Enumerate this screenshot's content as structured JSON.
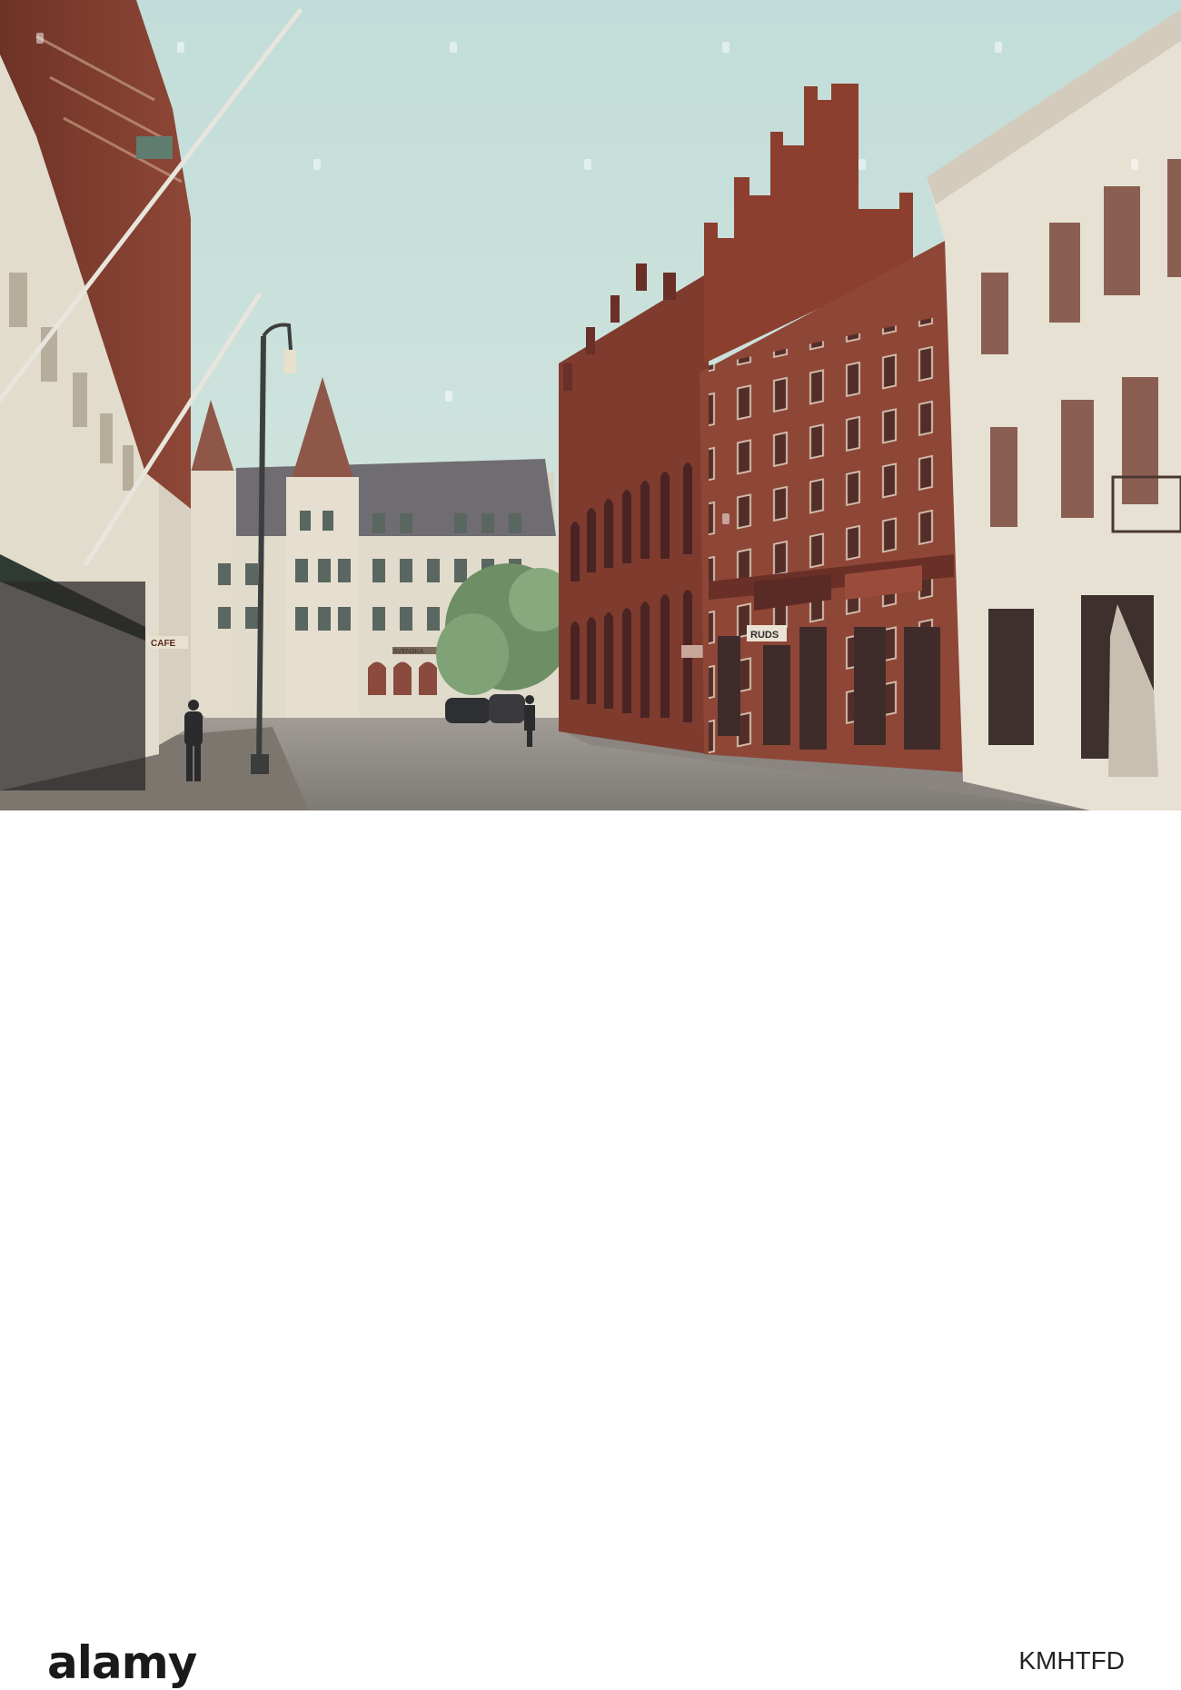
{
  "photo": {
    "description_colors": {
      "sky": "#cfe2df",
      "brick": "#7a3a2c",
      "plaster": "#e8e2d4",
      "street": "#8d8a86"
    },
    "shop_signs": [
      "CAFE",
      "RUDS"
    ],
    "building_sign": "SVENSKA"
  },
  "banner": {
    "logo": "alamy",
    "image_id": "KMHTFD"
  }
}
